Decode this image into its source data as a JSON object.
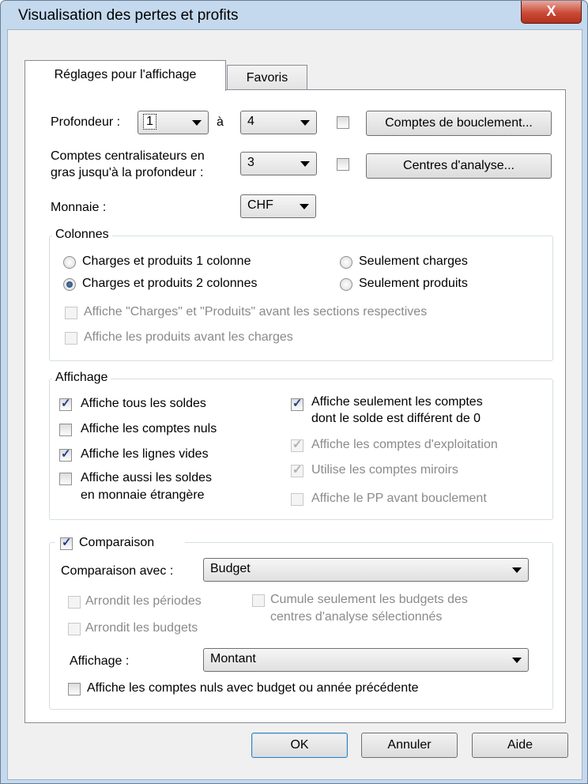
{
  "window": {
    "title": "Visualisation des pertes et profits",
    "close_glyph": "X"
  },
  "tabs": [
    {
      "label": "Réglages pour l'affichage",
      "active": true
    },
    {
      "label": "Favoris",
      "active": false
    }
  ],
  "settings": {
    "depth_label": "Profondeur :",
    "depth_from": "1",
    "depth_to_label": "à",
    "depth_to": "4",
    "closing_accounts_button": "Comptes de bouclement...",
    "bold_label_line1": "Comptes centralisateurs en",
    "bold_label_line2": "gras jusqu'à la profondeur :",
    "bold_depth": "3",
    "analysis_centers_button": "Centres d'analyse...",
    "currency_label": "Monnaie :",
    "currency": "CHF"
  },
  "columns": {
    "legend": "Colonnes",
    "one_column": "Charges et produits 1 colonne",
    "two_columns": "Charges et produits 2 colonnes",
    "only_charges": "Seulement charges",
    "only_products": "Seulement produits",
    "selected": "two_columns",
    "show_headers": "Affiche \"Charges\" et \"Produits\" avant les sections respectives",
    "products_before": "Affiche les produits avant les charges"
  },
  "display": {
    "legend": "Affichage",
    "all_balances": "Affiche tous les soldes",
    "null_accounts": "Affiche les comptes nuls",
    "empty_lines": "Affiche les lignes vides",
    "foreign_line1": "Affiche aussi les soldes",
    "foreign_line2": "en monnaie étrangère",
    "nonzero_line1": "Affiche seulement les comptes",
    "nonzero_line2": "dont le solde est différent de 0",
    "operating_accounts": "Affiche les comptes d'exploitation",
    "mirror_accounts": "Utilise les comptes miroirs",
    "pp_before": "Affiche le PP avant bouclement"
  },
  "comparison": {
    "legend": "Comparaison",
    "with_label": "Comparaison avec :",
    "with_value": "Budget",
    "round_periods": "Arrondit les périodes",
    "round_budgets": "Arrondit les budgets",
    "cumulate_line1": "Cumule seulement les budgets des",
    "cumulate_line2": "centres d'analyse sélectionnés",
    "display_label": "Affichage :",
    "display_value": "Montant",
    "null_with_budget": "Affiche les comptes nuls avec budget ou année précédente"
  },
  "footer": {
    "ok": "OK",
    "cancel": "Annuler",
    "help": "Aide"
  },
  "check_glyph": "✓"
}
